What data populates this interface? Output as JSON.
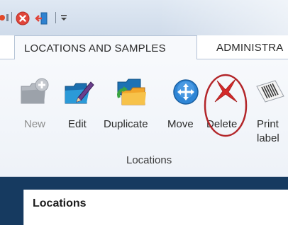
{
  "tabs": [
    {
      "label": "LOCATIONS AND SAMPLES",
      "active": true
    },
    {
      "label": "ADMINISTRA",
      "active": false
    }
  ],
  "ribbon": {
    "buttons": [
      {
        "label": "New",
        "icon": "folder-add-icon",
        "enabled": false
      },
      {
        "label": "Edit",
        "icon": "folder-edit-icon",
        "enabled": true
      },
      {
        "label": "Duplicate",
        "icon": "folder-duplicate-icon",
        "enabled": true
      },
      {
        "label": "Move",
        "icon": "move-arrows-icon",
        "enabled": true
      },
      {
        "label": "Delete",
        "icon": "red-x-icon",
        "enabled": true,
        "highlighted": true
      },
      {
        "label": "Print",
        "label_line2": "label",
        "icon": "barcode-icon",
        "enabled": true
      }
    ],
    "group_label": "Locations"
  },
  "panel": {
    "title": "Locations"
  },
  "colors": {
    "accent_dark": "#163a60",
    "delete_red": "#d42a2a",
    "highlight_circle": "#b3262a"
  }
}
